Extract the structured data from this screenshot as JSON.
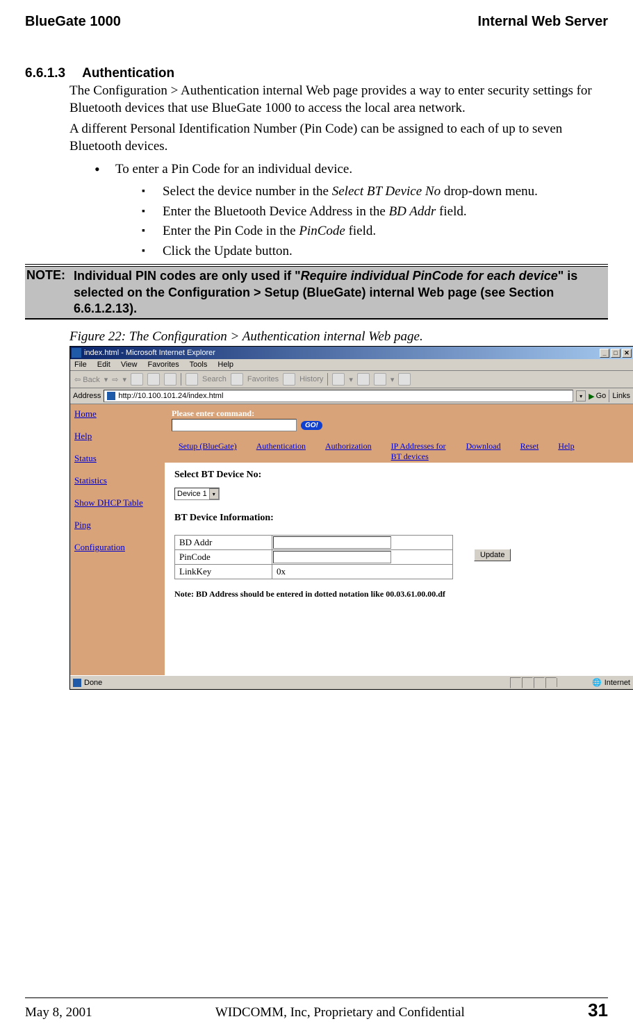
{
  "header": {
    "left": "BlueGate 1000",
    "right": "Internal Web Server"
  },
  "section": {
    "number": "6.6.1.3",
    "title": "Authentication",
    "para1": "The Configuration > Authentication internal Web page provides a way to enter security settings for Bluetooth devices that use BlueGate 1000 to access the local area network.",
    "para2": "A different Personal Identification Number (Pin Code) can be assigned to each of up to seven Bluetooth devices.",
    "bullet1": "To enter a Pin Code for an individual device.",
    "sub1_pre": "Select the device number in the ",
    "sub1_em": "Select BT Device No",
    "sub1_post": " drop-down menu.",
    "sub2_pre": "Enter the Bluetooth Device Address in the ",
    "sub2_em": "BD Addr",
    "sub2_post": " field.",
    "sub3_pre": "Enter the Pin Code in the ",
    "sub3_em": "PinCode",
    "sub3_post": " field.",
    "sub4": "Click the Update button."
  },
  "note": {
    "label": "NOTE:",
    "text_pre": "Individual PIN codes are only used if \"",
    "text_em": "Require individual PinCode for each device",
    "text_post": "\" is selected on the Configuration > Setup (BlueGate) internal Web page (see Section 6.6.1.2.13)."
  },
  "figure": {
    "caption": "Figure 22: The Configuration > Authentication internal Web page."
  },
  "screenshot": {
    "title": "index.html - Microsoft Internet Explorer",
    "menus": [
      "File",
      "Edit",
      "View",
      "Favorites",
      "Tools",
      "Help"
    ],
    "toolbar": {
      "back": "Back",
      "search": "Search",
      "favorites": "Favorites",
      "history": "History"
    },
    "address_label": "Address",
    "url": "http://10.100.101.24/index.html",
    "go": "Go",
    "links": "Links",
    "sidebar": [
      "Home",
      "Help",
      "Status",
      "Statistics",
      "Show DHCP Table",
      "Ping",
      "Configuration"
    ],
    "cmd_label": "Please enter command:",
    "go_btn": "GO!",
    "tabs": [
      "Setup (BlueGate)",
      "Authentication",
      "Authorization",
      "IP Addresses for BT devices",
      "Download",
      "Reset",
      "Help"
    ],
    "select_label": "Select BT Device No:",
    "select_value": "Device 1",
    "info_label": "BT Device Information:",
    "rows": {
      "bdaddr": "BD Addr",
      "pincode": "PinCode",
      "linkkey": "LinkKey",
      "linkkey_val": "0x"
    },
    "update": "Update",
    "form_note": "Note: BD Address should be entered in dotted notation like 00.03.61.00.00.df",
    "status_done": "Done",
    "status_zone": "Internet"
  },
  "footer": {
    "date": "May 8, 2001",
    "center": "WIDCOMM, Inc, Proprietary and Confidential",
    "page": "31"
  }
}
